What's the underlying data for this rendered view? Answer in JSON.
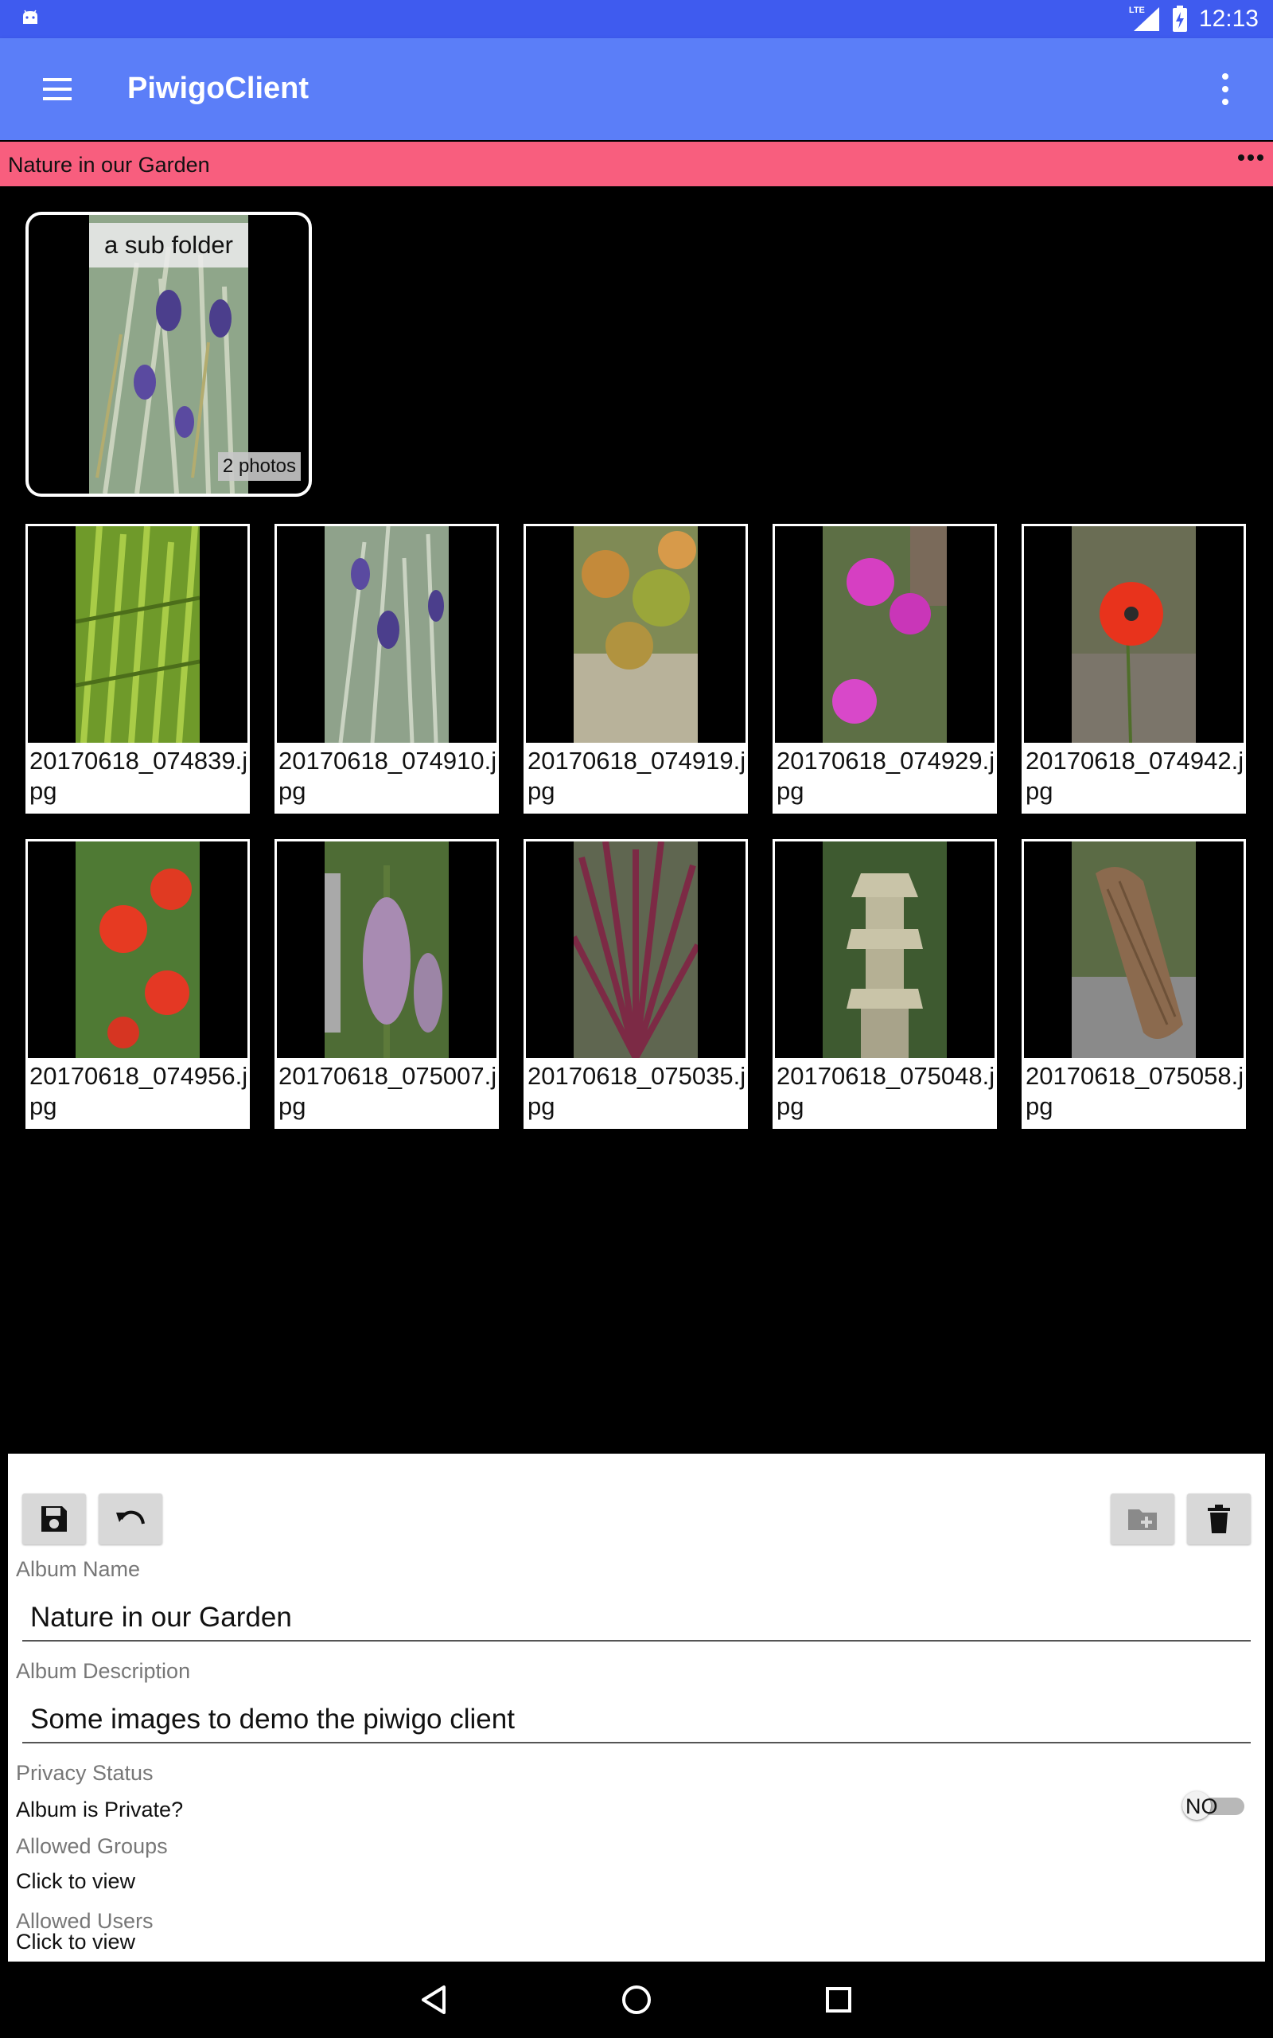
{
  "status_bar": {
    "time": "12:13",
    "network": "LTE"
  },
  "app_bar": {
    "title": "PiwigoClient"
  },
  "album_header": {
    "name": "Nature in our Garden"
  },
  "subfolder": {
    "name": "a sub folder",
    "count": "2 photos"
  },
  "photos": [
    {
      "caption": "20170618_074839.jpg"
    },
    {
      "caption": "20170618_074910.jpg"
    },
    {
      "caption": "20170618_074919.jpg"
    },
    {
      "caption": "20170618_074929.jpg"
    },
    {
      "caption": "20170618_074942.jpg"
    },
    {
      "caption": "20170618_074956.jpg"
    },
    {
      "caption": "20170618_075007.jpg"
    },
    {
      "caption": "20170618_075035.jpg"
    },
    {
      "caption": "20170618_075048.jpg"
    },
    {
      "caption": "20170618_075058.jpg"
    }
  ],
  "edit_panel": {
    "album_name_label": "Album Name",
    "album_name_value": "Nature in our Garden",
    "album_description_label": "Album Description",
    "album_description_value": "Some images to demo the piwigo client",
    "privacy_status_label": "Privacy Status",
    "album_private_question": "Album is Private?",
    "private_toggle_text": "NO",
    "allowed_groups_label": "Allowed Groups",
    "allowed_groups_value": "Click to view",
    "allowed_users_label": "Allowed Users",
    "allowed_users_value": "Click to view"
  },
  "colors": {
    "status_bar": "#3f5bef",
    "app_bar": "#5b7ef8",
    "album_header": "#f85e7e",
    "background": "#000000"
  }
}
